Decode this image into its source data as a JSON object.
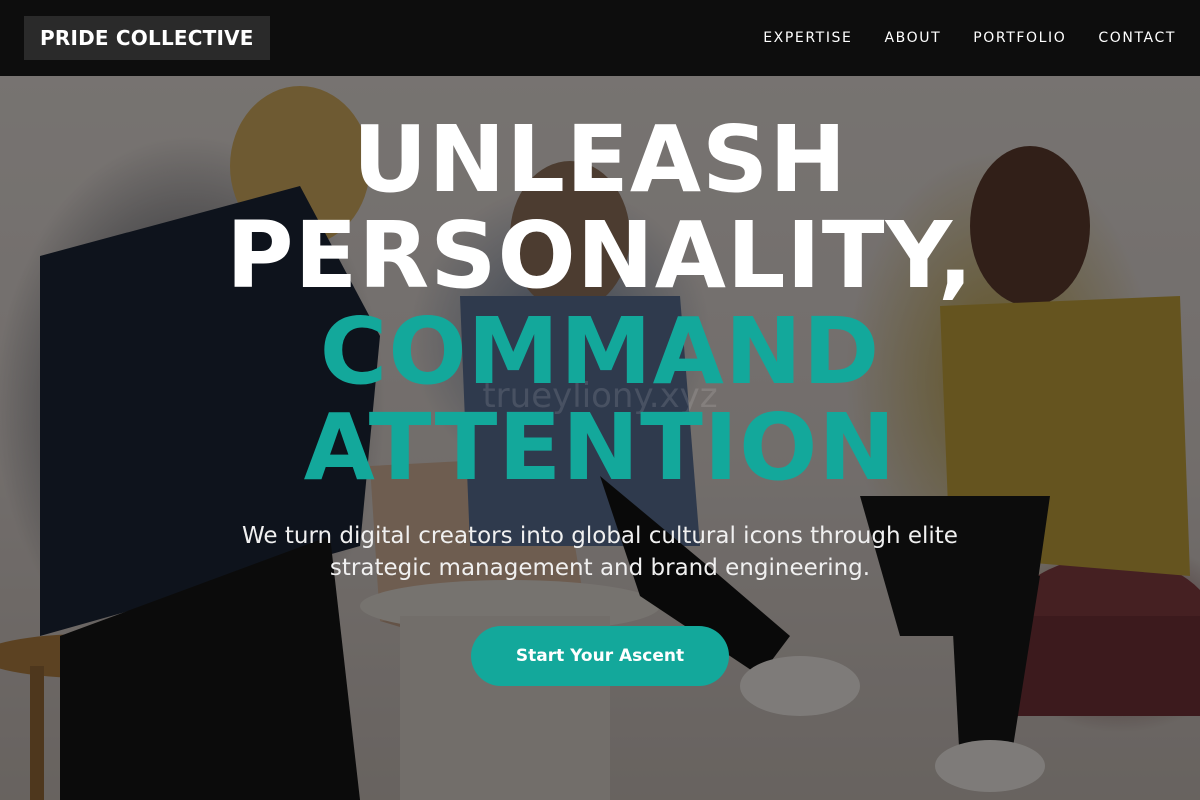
{
  "brand": {
    "name": "PRIDE COLLECTIVE"
  },
  "nav": {
    "items": [
      {
        "label": "EXPERTISE"
      },
      {
        "label": "ABOUT"
      },
      {
        "label": "PORTFOLIO"
      },
      {
        "label": "CONTACT"
      }
    ]
  },
  "hero": {
    "headline": {
      "line1": "UNLEASH",
      "line2": "PERSONALITY,",
      "line3": "COMMAND",
      "line4": "ATTENTION"
    },
    "subtitle": "We turn digital creators into global cultural icons through elite strategic management and brand engineering.",
    "cta_label": "Start Your Ascent",
    "watermark": "trueyliony.xyz"
  },
  "colors": {
    "accent": "#13a89b",
    "nav_background": "#0d0d0d",
    "logo_background": "#2a2a2a"
  }
}
